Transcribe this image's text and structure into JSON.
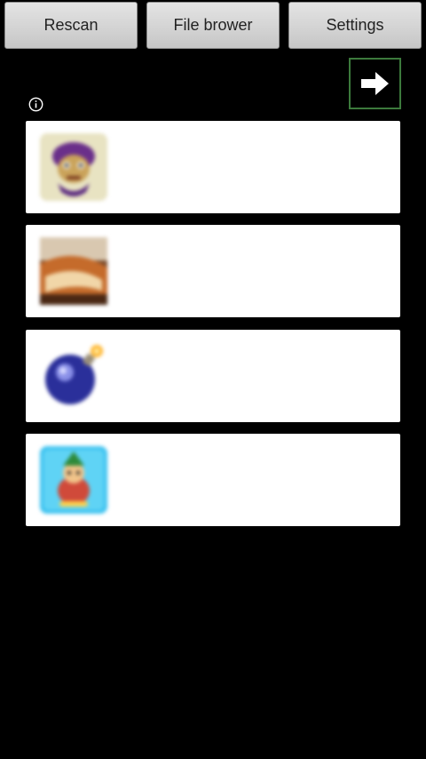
{
  "toolbar": {
    "rescan_label": "Rescan",
    "file_browser_label": "File brower",
    "settings_label": "Settings"
  },
  "icons": {
    "next": "arrow-right-icon",
    "info": "info-icon"
  },
  "games": [
    {
      "icon": "game-thumbnail-purple-character"
    },
    {
      "icon": "game-thumbnail-brown-scene"
    },
    {
      "icon": "game-thumbnail-blue-bomb"
    },
    {
      "icon": "game-thumbnail-blue-character"
    }
  ],
  "colors": {
    "background": "#000000",
    "item_background": "#ffffff",
    "next_border": "#3c7a3c"
  }
}
